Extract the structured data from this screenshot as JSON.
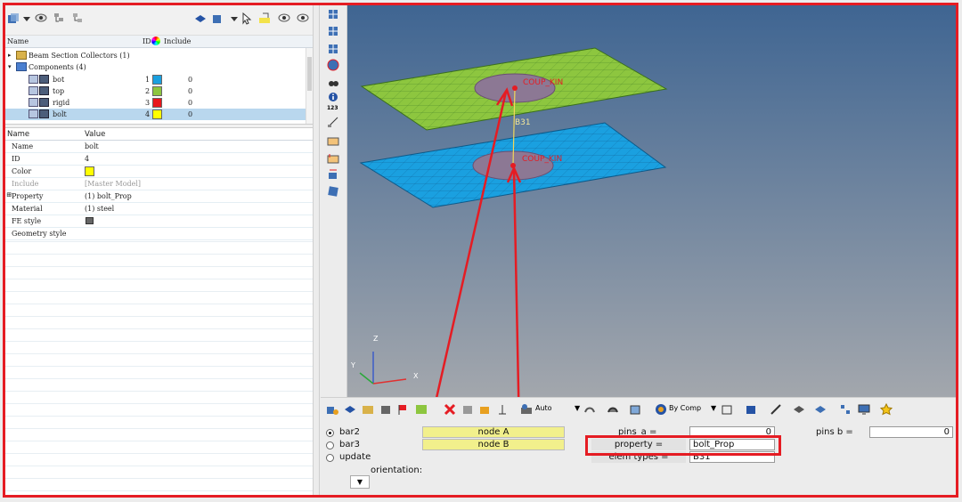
{
  "browser": {
    "columns": {
      "name": "Name",
      "id": "ID",
      "include": "Include"
    },
    "tree": [
      {
        "label": "Beam Section Collectors (1)"
      },
      {
        "label": "Components (4)"
      },
      {
        "label": "bot",
        "id": "1",
        "include": "0",
        "color": "#1aa0e0"
      },
      {
        "label": "top",
        "id": "2",
        "include": "0",
        "color": "#8dc63f"
      },
      {
        "label": "rigid",
        "id": "3",
        "include": "0",
        "color": "#e8161b"
      },
      {
        "label": "bolt",
        "id": "4",
        "include": "0",
        "color": "#ffff00"
      }
    ]
  },
  "props": {
    "columns": {
      "name": "Name",
      "value": "Value"
    },
    "rows": [
      {
        "name": "Name",
        "value": "bolt"
      },
      {
        "name": "ID",
        "value": "4"
      },
      {
        "name": "Color",
        "value": ""
      },
      {
        "name": "Include",
        "value": "[Master Model]"
      },
      {
        "name": "Property",
        "value": "(1) bolt_Prop"
      },
      {
        "name": "Material",
        "value": "(1) steel"
      },
      {
        "name": "FE style",
        "value": ""
      },
      {
        "name": "Geometry style",
        "value": ""
      }
    ]
  },
  "viewport": {
    "label_top": "COUP_KIN",
    "label_bottom": "COUP_KIN",
    "beam_label": "B31",
    "axes": {
      "z": "Z",
      "y": "Y",
      "x": "X"
    },
    "vtool_text": "123"
  },
  "toolbar": {
    "auto": "Auto",
    "by_comp": "By Comp"
  },
  "panel": {
    "radios": [
      {
        "label": "bar2",
        "selected": true
      },
      {
        "label": "bar3",
        "selected": false
      },
      {
        "label": "update",
        "selected": false
      }
    ],
    "node_a": "node A",
    "node_b": "node B",
    "orientation": "orientation:",
    "pins_a_label": "pins_a =",
    "pins_a_value": "0",
    "pins_b_label": "pins b =",
    "pins_b_value": "0",
    "property_label": "property =",
    "property_value": "bolt_Prop",
    "elem_types_label": "elem types =",
    "elem_types_value": "B31"
  },
  "colors": {
    "highlight": "#e51c23",
    "top_plate": "#8dc63f",
    "bot_plate": "#1aa0e0"
  }
}
